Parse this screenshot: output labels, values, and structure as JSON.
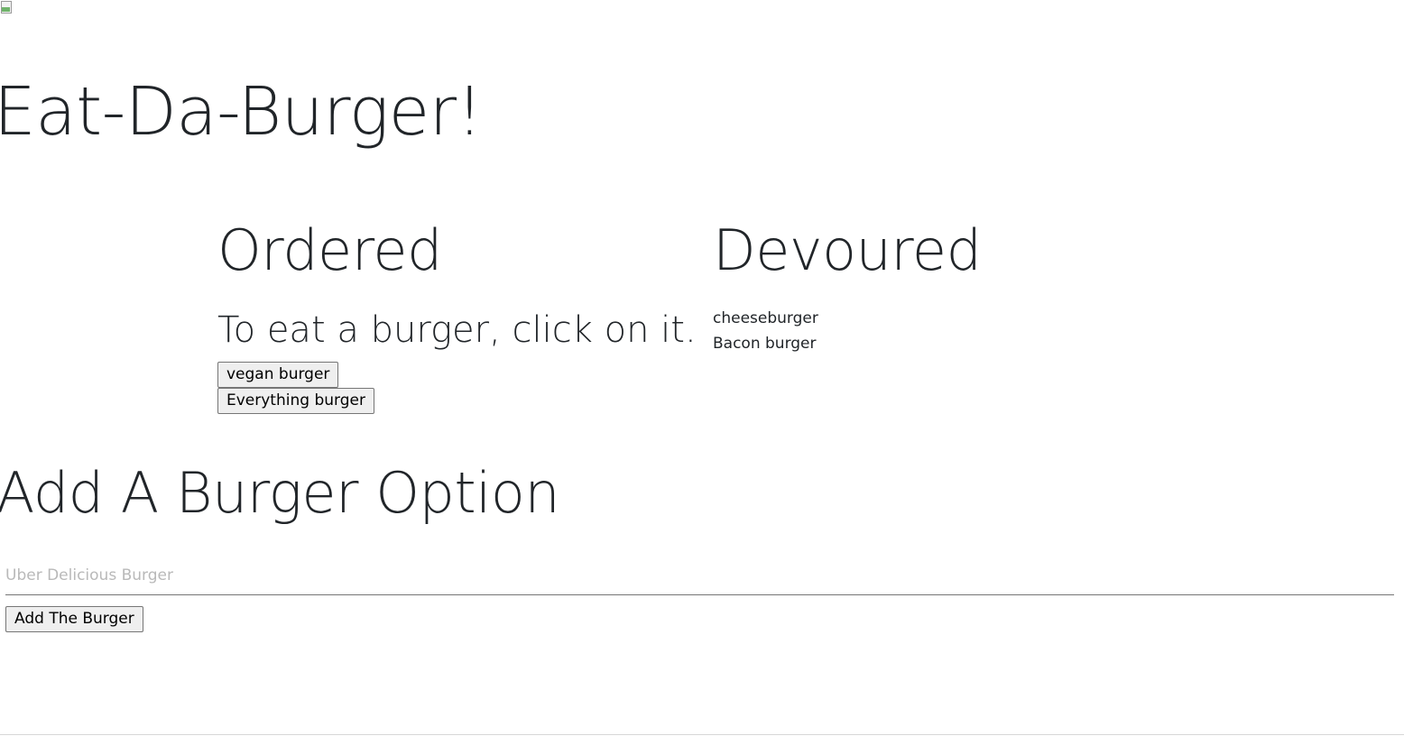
{
  "header": {
    "logo_icon": "broken-image-icon",
    "title": "Eat-Da-Burger!"
  },
  "ordered": {
    "heading": "Ordered",
    "instruction": "To eat a burger, click on it.",
    "burgers": [
      "vegan burger",
      "Everything burger"
    ]
  },
  "devoured": {
    "heading": "Devoured",
    "burgers": [
      "cheeseburger",
      "Bacon burger"
    ]
  },
  "add_form": {
    "heading": "Add A Burger Option",
    "input_placeholder": "Uber Delicious Burger",
    "input_value": "",
    "submit_label": "Add The Burger"
  }
}
